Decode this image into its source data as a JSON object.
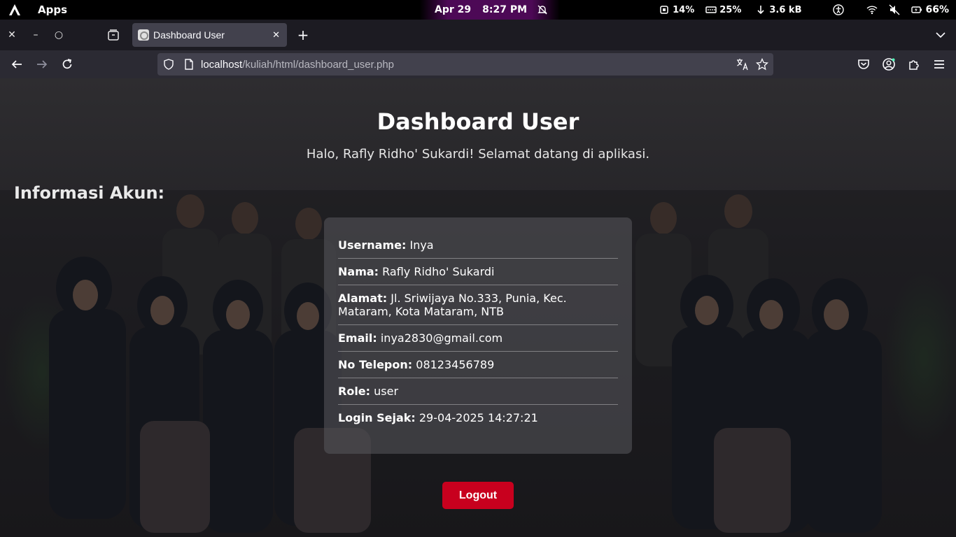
{
  "system_bar": {
    "apps_label": "Apps",
    "date": "Apr 29",
    "time": "8:27 PM",
    "cpu": "14%",
    "memory": "25%",
    "network": "3.6 kB",
    "battery": "66%"
  },
  "browser": {
    "tab_title": "Dashboard User",
    "url_host": "localhost",
    "url_path": "/kuliah/html/dashboard_user.php"
  },
  "page": {
    "title": "Dashboard User",
    "subtitle": "Halo, Rafly Ridho' Sukardi! Selamat datang di aplikasi.",
    "section_title": "Informasi Akun:",
    "info": [
      {
        "label": "Username:",
        "value": "Inya"
      },
      {
        "label": "Nama:",
        "value": "Rafly Ridho' Sukardi"
      },
      {
        "label": "Alamat:",
        "value": "Jl. Sriwijaya No.333, Punia, Kec. Mataram, Kota Mataram, NTB"
      },
      {
        "label": "Email:",
        "value": "inya2830@gmail.com"
      },
      {
        "label": "No Telepon:",
        "value": "08123456789"
      },
      {
        "label": "Role:",
        "value": "user"
      },
      {
        "label": "Login Sejak:",
        "value": "29-04-2025 14:27:21"
      }
    ],
    "logout_label": "Logout"
  },
  "colors": {
    "logout_button": "#c8001e",
    "tab_active": "#42414d",
    "nav_bar": "#2b2a33"
  }
}
